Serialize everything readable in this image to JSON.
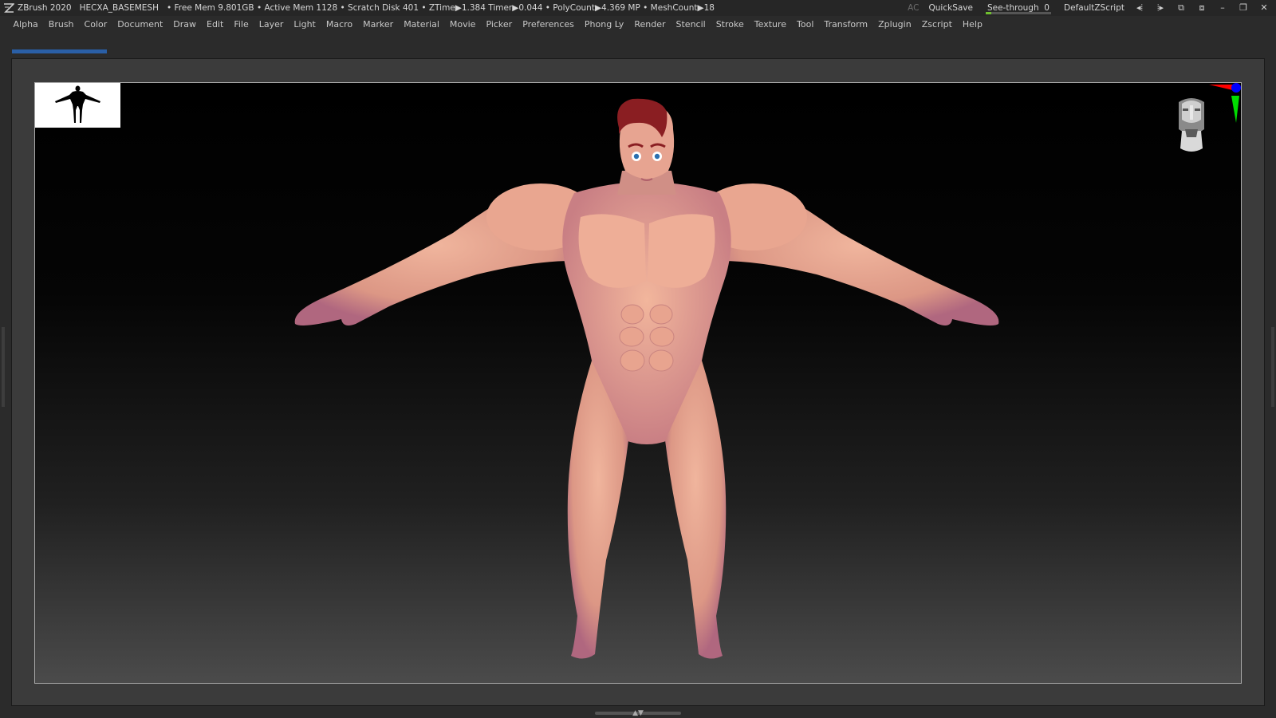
{
  "titlebar": {
    "app": "ZBrush 2020",
    "project": "HECXA_BASEMESH",
    "stats": "• Free Mem 9.801GB • Active Mem 1128 • Scratch Disk 401 • ZTime▶1.384 Timer▶0.044 • PolyCount▶4.369 MP • MeshCount▶18",
    "ac_label": "AC",
    "quicksave_label": "QuickSave",
    "seethrough_label": "See-through",
    "seethrough_value": "0",
    "seethrough_level": 0.08,
    "script_label": "DefaultZScript",
    "icons": [
      "zbrush-logo-icon",
      "lightbox-icon",
      "dock-left-icon",
      "dock-right-icon",
      "minimize-icon",
      "maximize-icon",
      "close-icon"
    ]
  },
  "menu": {
    "items": [
      "Alpha",
      "Brush",
      "Color",
      "Document",
      "Draw",
      "Edit",
      "File",
      "Layer",
      "Light",
      "Macro",
      "Marker",
      "Material",
      "Movie",
      "Picker",
      "Preferences",
      "Phong Ly",
      "Render",
      "Stencil",
      "Stroke",
      "Texture",
      "Tool",
      "Transform",
      "Zplugin",
      "Zscript",
      "Help"
    ]
  },
  "colors": {
    "accent_tab": "#2a5fa6",
    "seethrough_fill": "#6fbf2f",
    "skin": "#e3a08b",
    "hair": "#8a1e22",
    "axis_x": "#ff0000",
    "axis_y": "#00ff00",
    "axis_z": "#0000ff"
  }
}
